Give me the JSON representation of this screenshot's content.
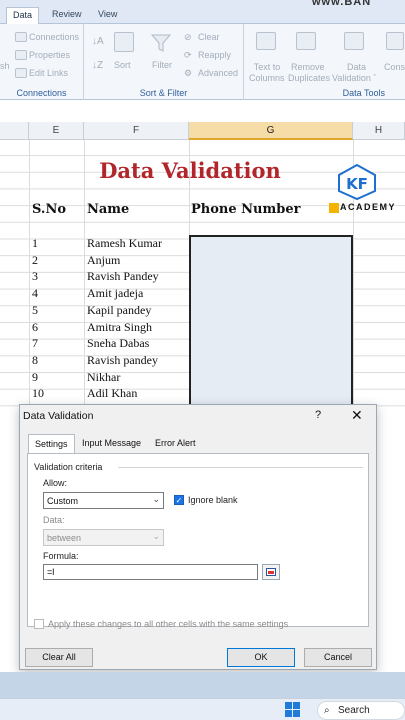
{
  "ribbon": {
    "tabs": [
      "Data",
      "Review",
      "View"
    ],
    "groups": {
      "connections": {
        "label": "Connections",
        "items": [
          "Connections",
          "Properties",
          "Edit Links"
        ],
        "cut_text": [
          "sh"
        ]
      },
      "sort_filter": {
        "label": "Sort & Filter",
        "sort": "Sort",
        "filter": "Filter",
        "clear": "Clear",
        "reapply": "Reapply",
        "advanced": "Advanced"
      },
      "data_tools": {
        "label": "Data Tools",
        "text_to_columns": [
          "Text to",
          "Columns"
        ],
        "remove_duplicates": [
          "Remove",
          "Duplicates"
        ],
        "data_validation": [
          "Data",
          "Validation ˇ"
        ],
        "consolidate": "Conso"
      }
    },
    "watermark": "www.BAN"
  },
  "sheet": {
    "columns": [
      "E",
      "F",
      "G",
      "H"
    ],
    "title": "Data Validation",
    "logo": {
      "mark": "KF",
      "text": "ACADEMY"
    },
    "headers": {
      "sno": "S.No",
      "name": "Name",
      "phone": "Phone Number"
    },
    "rows": [
      {
        "sno": "1",
        "name": "Ramesh Kumar"
      },
      {
        "sno": "2",
        "name": "Anjum"
      },
      {
        "sno": "3",
        "name": "Ravish Pandey"
      },
      {
        "sno": "4",
        "name": "Amit jadeja"
      },
      {
        "sno": "5",
        "name": "Kapil pandey"
      },
      {
        "sno": "6",
        "name": "Amitra Singh"
      },
      {
        "sno": "7",
        "name": "Sneha Dabas"
      },
      {
        "sno": "8",
        "name": "Ravish pandey"
      },
      {
        "sno": "9",
        "name": "Nikhar"
      },
      {
        "sno": "10",
        "name": "Adil Khan"
      }
    ]
  },
  "dialog": {
    "title": "Data Validation",
    "help": "?",
    "close": "✕",
    "tabs": [
      "Settings",
      "Input Message",
      "Error Alert"
    ],
    "criteria_label": "Validation criteria",
    "allow_label": "Allow:",
    "allow_value": "Custom",
    "ignore_blank": "Ignore blank",
    "data_label": "Data:",
    "data_value": "between",
    "formula_label": "Formula:",
    "formula_value": "=l",
    "apply_all": "Apply these changes to all other cells with the same settings",
    "buttons": {
      "clear_all": "Clear All",
      "ok": "OK",
      "cancel": "Cancel"
    }
  },
  "taskbar": {
    "search": "Search"
  },
  "colors": {
    "title": "#b0262b",
    "selected_column": "#f6dca6",
    "accent": "#1a73e8"
  }
}
